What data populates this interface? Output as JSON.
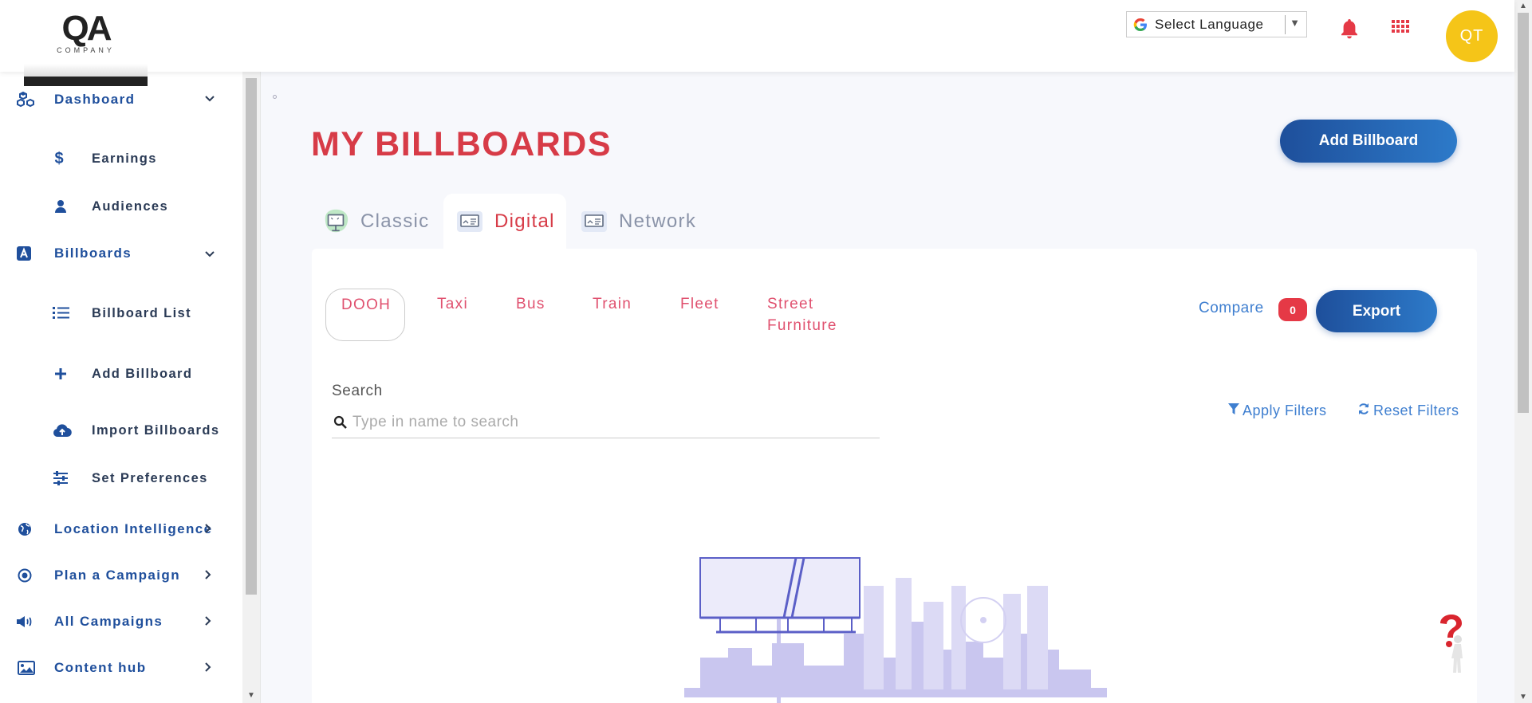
{
  "header": {
    "logo_mark": "QA",
    "logo_sub": "COMPANY",
    "language_label": "Select Language",
    "avatar_initials": "QT"
  },
  "sidebar": {
    "items": [
      {
        "label": "Dashboard",
        "icon": "cubes-icon",
        "chevron": "⌄"
      },
      {
        "label": "Earnings",
        "icon": "dollar-icon"
      },
      {
        "label": "Audiences",
        "icon": "user-icon"
      },
      {
        "label": "Billboards",
        "icon": "billboard-a-icon",
        "chevron": "⌄"
      },
      {
        "label": "Billboard List",
        "icon": "list-icon"
      },
      {
        "label": "Add Billboard",
        "icon": "plus-icon"
      },
      {
        "label": "Import Billboards",
        "icon": "cloud-upload-icon"
      },
      {
        "label": "Set Preferences",
        "icon": "sliders-icon"
      },
      {
        "label": "Location Intelligence",
        "icon": "globe-icon",
        "chevron": "›"
      },
      {
        "label": "Plan a Campaign",
        "icon": "target-icon",
        "chevron": "›"
      },
      {
        "label": "All Campaigns",
        "icon": "megaphone-icon",
        "chevron": "›"
      },
      {
        "label": "Content hub",
        "icon": "image-icon",
        "chevron": "›"
      }
    ]
  },
  "main": {
    "title": "MY BILLBOARDS",
    "add_button": "Add Billboard",
    "tabs": [
      {
        "label": "Classic",
        "active": false
      },
      {
        "label": "Digital",
        "active": true
      },
      {
        "label": "Network",
        "active": false
      }
    ],
    "subtabs": [
      {
        "label": "DOOH",
        "active": true
      },
      {
        "label": "Taxi"
      },
      {
        "label": "Bus"
      },
      {
        "label": "Train"
      },
      {
        "label": "Fleet"
      },
      {
        "label": "Street",
        "label2": "Furniture"
      }
    ],
    "compare_label": "Compare",
    "compare_count": "0",
    "export_label": "Export",
    "search": {
      "label": "Search",
      "placeholder": "Type in name to search"
    },
    "apply_filters": "Apply Filters",
    "reset_filters": "Reset Filters"
  },
  "colors": {
    "brand_blue": "#1f4f9c",
    "accent_red": "#d73b47",
    "avatar_yellow": "#f5c518"
  }
}
